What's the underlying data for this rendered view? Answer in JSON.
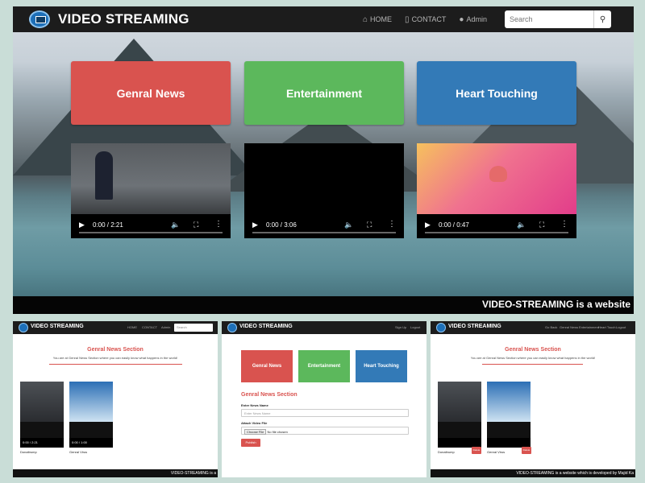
{
  "main": {
    "brand": "VIDEO STREAMING",
    "nav": [
      {
        "icon": "home-icon",
        "glyph": "⌂",
        "label": "HOME"
      },
      {
        "icon": "phone-icon",
        "glyph": "▯",
        "label": "CONTACT"
      },
      {
        "icon": "user-icon",
        "glyph": "●",
        "label": "Admin"
      }
    ],
    "search": {
      "placeholder": "Search",
      "icon": "search-icon"
    },
    "categories": [
      {
        "label": "Genral News",
        "color": "#d9534f"
      },
      {
        "label": "Entertainment",
        "color": "#5cb85c"
      },
      {
        "label": "Heart Touching",
        "color": "#337ab7"
      }
    ],
    "videos": [
      {
        "time": "0:00 / 2:21",
        "progress": 0
      },
      {
        "time": "0:00 / 3:06",
        "progress": 0
      },
      {
        "time": "0:00 / 0:47",
        "progress": 0
      }
    ],
    "footer": "VIDEO-STREAMING is a website"
  },
  "screen1": {
    "brand": "VIDEO STREAMING",
    "nav": [
      "HOME",
      "CONTACT",
      "Admin"
    ],
    "search_placeholder": "Search",
    "title": "Genral News Section",
    "subtitle": "You are at Genral News Section where you can easily know what happens in the world!",
    "videos": [
      {
        "label": "Donaltrump",
        "time": "0:00 / 2:21"
      },
      {
        "label": "Genral Virus",
        "time": "0:00 / 1:00"
      }
    ],
    "footer": "VIDEO-STREAMING is a"
  },
  "screen2": {
    "brand": "VIDEO STREAMING",
    "nav": [
      "Sign Up",
      "Logout"
    ],
    "categories": [
      {
        "label": "Genral News",
        "color": "#d9534f"
      },
      {
        "label": "Entertainment",
        "color": "#5cb85c"
      },
      {
        "label": "Heart Touching",
        "color": "#337ab7"
      }
    ],
    "form_title": "Genral News Section",
    "name_label": "Enter News Name",
    "name_placeholder": "Enter News Name",
    "file_label": "Attach Video File",
    "file_button": "Choose File",
    "file_status": "No file chosen",
    "publish_label": "Publish"
  },
  "screen3": {
    "brand": "VIDEO STREAMING",
    "nav": [
      "Go Back",
      "Genral News",
      "Entertainment",
      "Heart Touch",
      "Logout"
    ],
    "title": "Genral News Section",
    "subtitle": "You are at Genral News Section where you can easily know what happens in the world!",
    "videos": [
      {
        "label": "Donaltrump",
        "delete": "Delete"
      },
      {
        "label": "Genral Virus",
        "delete": "Delete"
      }
    ],
    "footer": "VIDEO-STREAMING is a website which is developed by Majid Ka"
  }
}
